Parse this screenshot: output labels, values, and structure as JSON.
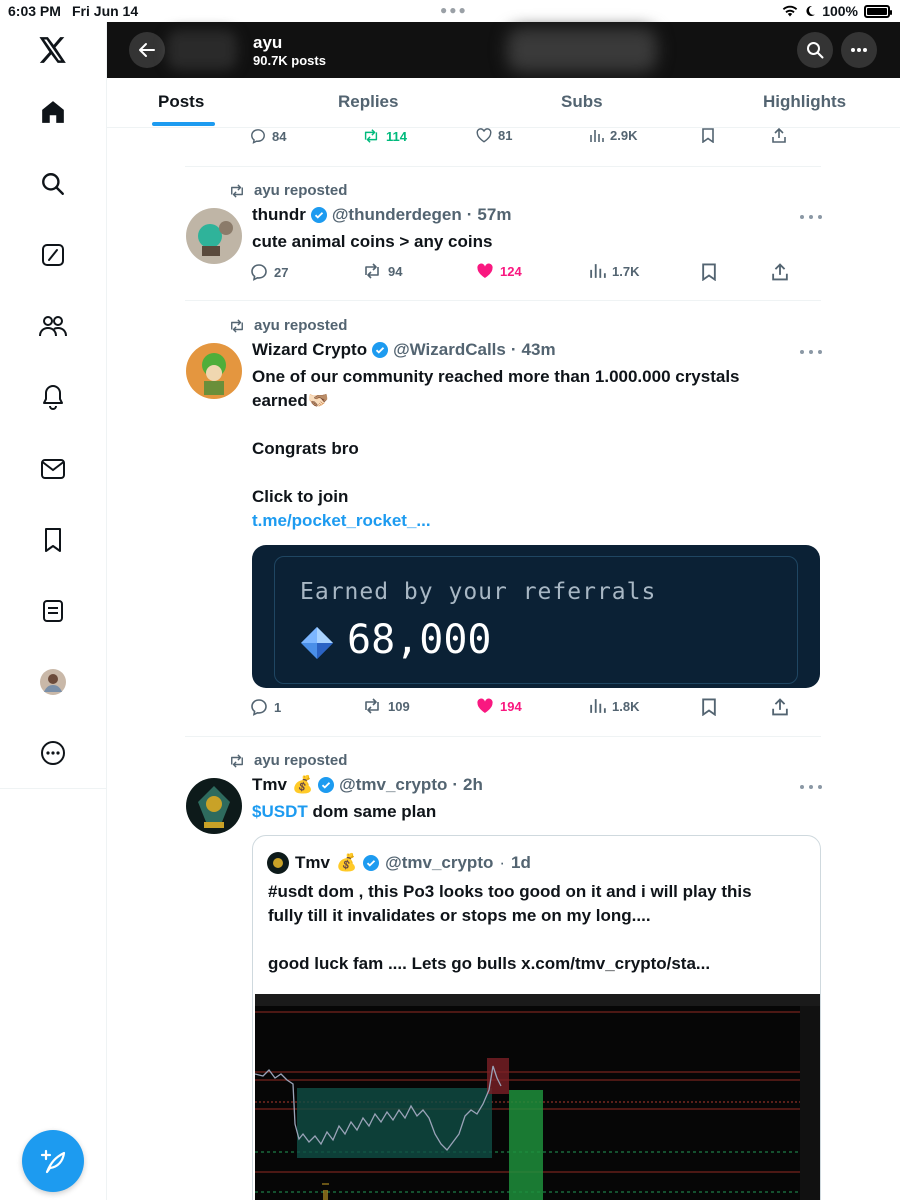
{
  "status_bar": {
    "time": "6:03 PM",
    "date": "Fri Jun 14",
    "battery": "100%"
  },
  "header": {
    "name": "ayu",
    "post_count": "90.7K posts"
  },
  "tabs": [
    "Posts",
    "Replies",
    "Subs",
    "Highlights"
  ],
  "colors": {
    "accent": "#1d9bf0",
    "like": "#f91880",
    "repost": "#00ba7c",
    "muted": "#536471"
  },
  "left_nav_icons": [
    "x-logo",
    "home-icon",
    "search-icon",
    "grok-icon",
    "communities-icon",
    "notifications-icon",
    "messages-icon",
    "bookmarks-icon",
    "lists-icon",
    "profile-avatar",
    "more-icon"
  ],
  "top_actions": {
    "replies": "84",
    "reposts": "114",
    "likes": "81",
    "views": "2.9K"
  },
  "posts": [
    {
      "repost_label": "ayu reposted",
      "name": "thundr",
      "handle": "@thunderdegen",
      "time": "57m",
      "text": "cute animal coins > any coins",
      "replies": "27",
      "reposts": "94",
      "likes": "124",
      "views": "1.7K"
    },
    {
      "repost_label": "ayu reposted",
      "name": "Wizard Crypto",
      "handle": "@WizardCalls",
      "time": "43m",
      "text_line1": "One of our community reached more than 1.000.000 crystals",
      "text_line2": "earned🫱🏻‍🫲🏽",
      "text_line3": "Congrats bro",
      "text_line4": "Click to join",
      "link": "t.me/pocket_rocket_...",
      "card_label": "Earned by your referrals",
      "card_value": "68,000",
      "replies": "1",
      "reposts": "109",
      "likes": "194",
      "views": "1.8K"
    },
    {
      "repost_label": "ayu reposted",
      "name": "Tmv",
      "emoji": "💰",
      "handle": "@tmv_crypto",
      "time": "2h",
      "cashtag": "$USDT",
      "text": " dom same plan",
      "quote": {
        "name": "Tmv",
        "emoji": "💰",
        "handle": "@tmv_crypto",
        "time": "1d",
        "text_line1": "#usdt dom , this Po3 looks too good on it and i will play this",
        "text_line2": "fully till it invalidates or stops me on my long....",
        "text_line3": "good luck fam .... Lets go bulls x.com/tmv_crypto/sta..."
      }
    }
  ]
}
